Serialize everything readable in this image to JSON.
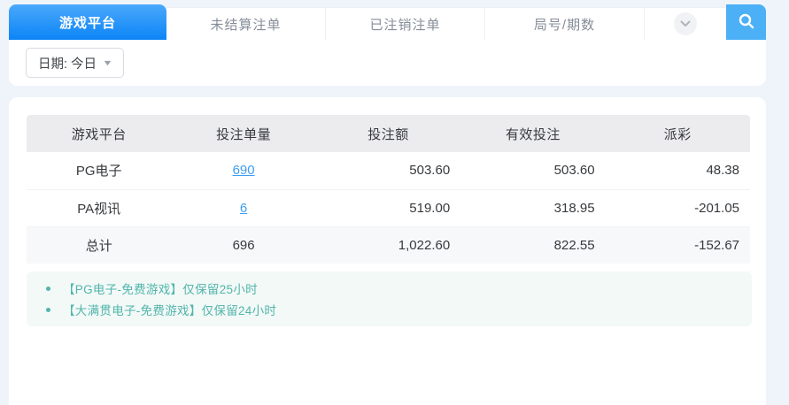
{
  "tabs": [
    {
      "label": "游戏平台",
      "active": true
    },
    {
      "label": "未结算注单",
      "active": false
    },
    {
      "label": "已注销注单",
      "active": false
    },
    {
      "label": "局号/期数",
      "active": false
    }
  ],
  "filter": {
    "date_label": "日期: 今日"
  },
  "table": {
    "headers": [
      "游戏平台",
      "投注单量",
      "投注额",
      "有效投注",
      "派彩"
    ],
    "rows": [
      {
        "platform": "PG电子",
        "count": "690",
        "bet_amount": "503.60",
        "valid_bet": "503.60",
        "payout": "48.38"
      },
      {
        "platform": "PA视讯",
        "count": "6",
        "bet_amount": "519.00",
        "valid_bet": "318.95",
        "payout": "-201.05"
      }
    ],
    "total": {
      "platform": "总计",
      "count": "696",
      "bet_amount": "1,022.60",
      "valid_bet": "822.55",
      "payout": "-152.67"
    }
  },
  "notes": [
    "【PG电子-免费游戏】仅保留25小时",
    "【大满贯电子-免费游戏】仅保留24小时"
  ],
  "colors": {
    "accent_blue": "#0c84f7",
    "search_blue": "#4bb0f6",
    "link_blue": "#3f9ef2",
    "negative_pink": "#f85a7f",
    "note_teal": "#52b5ab",
    "page_bg": "#eff4fb"
  }
}
